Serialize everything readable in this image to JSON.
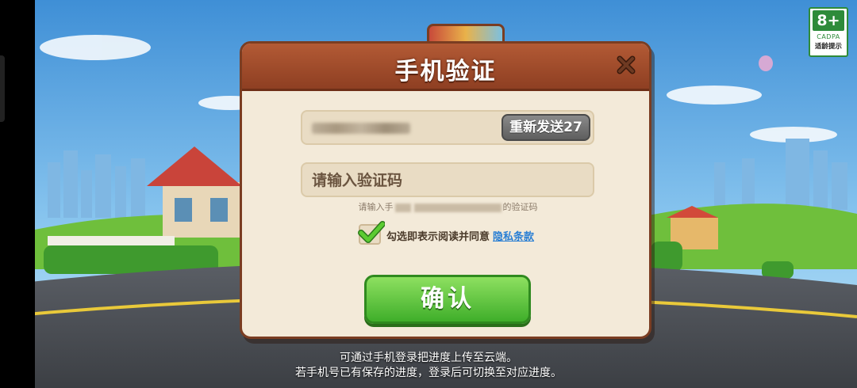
{
  "age_badge": {
    "rating": "8+",
    "org": "CADPA",
    "label": "适龄提示"
  },
  "dialog": {
    "title": "手机验证",
    "close_icon": "close-x-icon",
    "resend_label": "重新发送27",
    "code_placeholder": "请输入验证码",
    "hint_prefix": "请输入手",
    "hint_suffix": "的验证码",
    "agree_text": "勾选即表示阅读并同意",
    "privacy_link": "隐私条款",
    "checkbox_checked": true,
    "confirm_label": "确认"
  },
  "footer": {
    "line1": "可通过手机登录把进度上传至云端。",
    "line2": "若手机号已有保存的进度，登录后可切换至对应进度。"
  },
  "colors": {
    "header": "#9c4a2a",
    "panel": "#f3ead9",
    "confirm": "#4cbb34",
    "resend": "#707070",
    "link": "#2a7fd4",
    "badge": "#2e8b3a"
  }
}
